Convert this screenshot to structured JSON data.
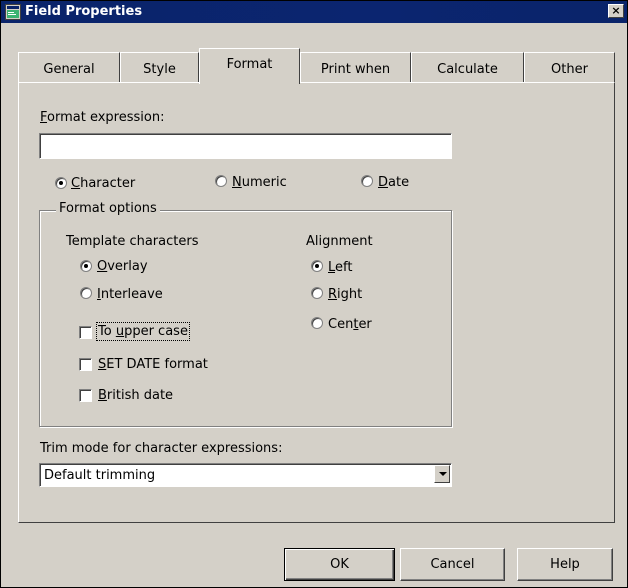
{
  "window": {
    "title": "Field Properties",
    "close_glyph": "×"
  },
  "tabs": [
    {
      "label": "General",
      "active": false
    },
    {
      "label": "Style",
      "active": false
    },
    {
      "label": "Format",
      "active": true
    },
    {
      "label": "Print when",
      "active": false
    },
    {
      "label": "Calculate",
      "active": false
    },
    {
      "label": "Other",
      "active": false
    }
  ],
  "format": {
    "expression_label_hotkey": "F",
    "expression_label_rest": "ormat expression:",
    "expression_value": "",
    "type_options": [
      {
        "hotkey": "C",
        "rest": "haracter",
        "checked": true
      },
      {
        "hotkey": "N",
        "rest": "umeric",
        "checked": false
      },
      {
        "hotkey": "D",
        "rest": "ate",
        "checked": false
      }
    ],
    "options_group_label": "Format options",
    "template_label": "Template characters",
    "template_options": [
      {
        "hotkey": "O",
        "rest": "verlay",
        "checked": true
      },
      {
        "hotkey": "I",
        "rest": "nterleave",
        "checked": false
      }
    ],
    "alignment_label": "Alignment",
    "alignment_options": [
      {
        "pre": "",
        "hotkey": "L",
        "rest": "eft",
        "checked": true
      },
      {
        "pre": "",
        "hotkey": "R",
        "rest": "ight",
        "checked": false
      },
      {
        "pre": "Cen",
        "hotkey": "t",
        "rest": "er",
        "checked": false
      }
    ],
    "checkboxes": [
      {
        "pre": "To ",
        "hotkey": "u",
        "rest": "pper case",
        "checked": false
      },
      {
        "pre": "",
        "hotkey": "S",
        "rest": "ET DATE format",
        "checked": false
      },
      {
        "pre": "",
        "hotkey": "B",
        "rest": "ritish date",
        "checked": false
      }
    ],
    "trim_label": "Trim mode for character expressions:",
    "trim_value": "Default trimming"
  },
  "buttons": {
    "ok": "OK",
    "cancel": "Cancel",
    "help": "Help"
  },
  "colors": {
    "titlebar": "#0a246a",
    "face": "#d4d0c8"
  },
  "icons": {
    "title_icon": "field-properties-icon",
    "close": "close-icon",
    "dropdown": "dropdown-arrow-icon"
  }
}
